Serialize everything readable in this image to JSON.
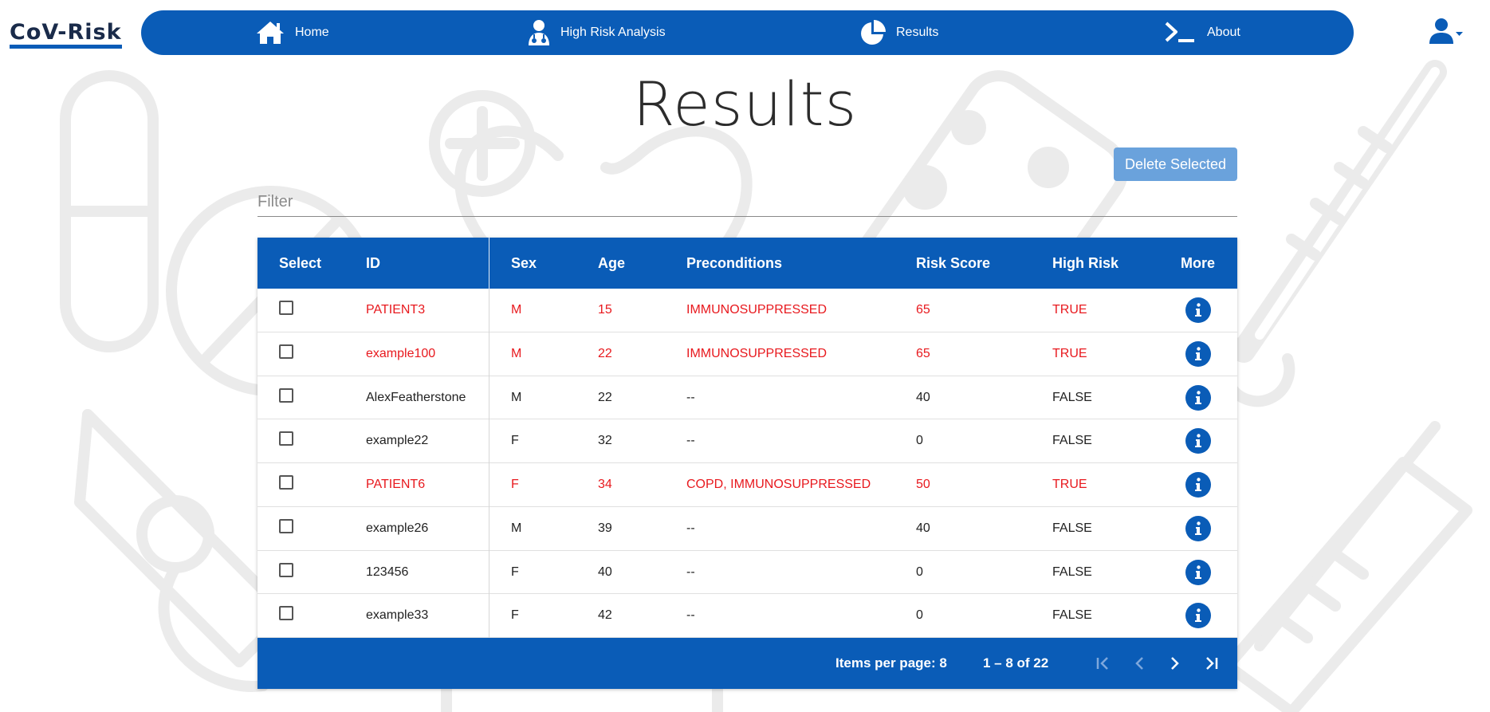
{
  "brand": {
    "name": "CoV-Risk"
  },
  "nav": {
    "items": [
      {
        "label": "Home",
        "icon": "home-icon"
      },
      {
        "label": "High Risk Analysis",
        "icon": "doctor-icon"
      },
      {
        "label": "Results",
        "icon": "pie-chart-icon"
      },
      {
        "label": "About",
        "icon": "terminal-icon"
      }
    ],
    "user_icon": "user-icon"
  },
  "page": {
    "title": "Results"
  },
  "actions": {
    "delete_selected": "Delete Selected"
  },
  "filter": {
    "placeholder": "Filter",
    "value": ""
  },
  "table": {
    "headers": {
      "select": "Select",
      "id": "ID",
      "sex": "Sex",
      "age": "Age",
      "preconditions": "Preconditions",
      "risk_score": "Risk Score",
      "high_risk": "High Risk",
      "more": "More"
    },
    "rows": [
      {
        "id": "PATIENT3",
        "sex": "M",
        "age": "15",
        "preconditions": "IMMUNOSUPPRESSED",
        "risk_score": "65",
        "high_risk": "TRUE"
      },
      {
        "id": "example100",
        "sex": "M",
        "age": "22",
        "preconditions": "IMMUNOSUPPRESSED",
        "risk_score": "65",
        "high_risk": "TRUE"
      },
      {
        "id": "AlexFeatherstone",
        "sex": "M",
        "age": "22",
        "preconditions": "--",
        "risk_score": "40",
        "high_risk": "FALSE"
      },
      {
        "id": "example22",
        "sex": "F",
        "age": "32",
        "preconditions": "--",
        "risk_score": "0",
        "high_risk": "FALSE"
      },
      {
        "id": "PATIENT6",
        "sex": "F",
        "age": "34",
        "preconditions": "COPD, IMMUNOSUPPRESSED",
        "risk_score": "50",
        "high_risk": "TRUE"
      },
      {
        "id": "example26",
        "sex": "M",
        "age": "39",
        "preconditions": "--",
        "risk_score": "40",
        "high_risk": "FALSE"
      },
      {
        "id": "123456",
        "sex": "F",
        "age": "40",
        "preconditions": "--",
        "risk_score": "0",
        "high_risk": "FALSE"
      },
      {
        "id": "example33",
        "sex": "F",
        "age": "42",
        "preconditions": "--",
        "risk_score": "0",
        "high_risk": "FALSE"
      }
    ]
  },
  "paginator": {
    "items_per_page_label": "Items per page: 8",
    "range_label": "1 – 8 of 22"
  },
  "colors": {
    "primary": "#0a5cb7",
    "risk_text": "#e8191e",
    "delete_button": "#6aa2dc"
  }
}
